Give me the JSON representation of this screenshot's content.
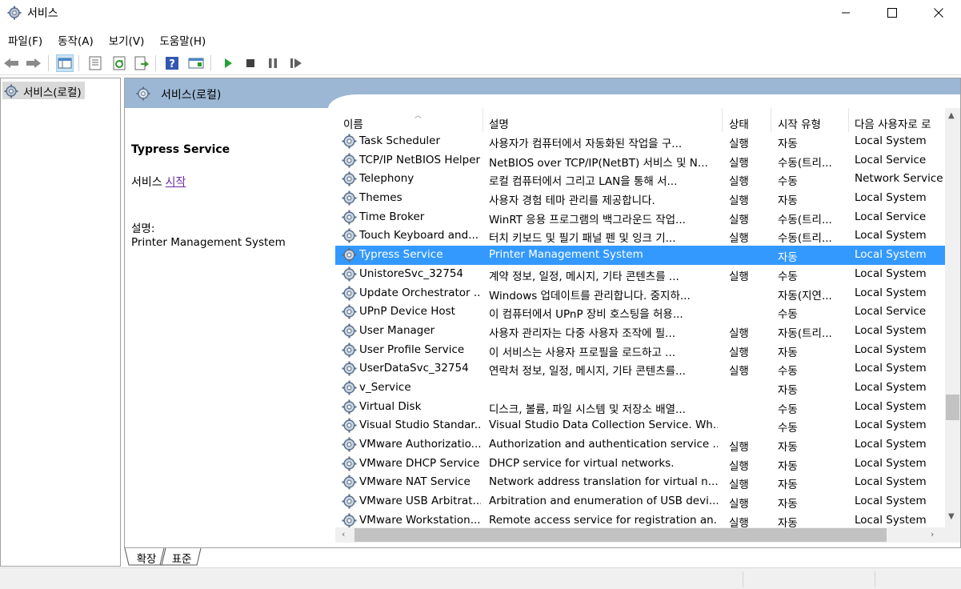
{
  "window": {
    "title": "서비스"
  },
  "menu": [
    "파일(F)",
    "동작(A)",
    "보기(V)",
    "도움말(H)"
  ],
  "toolbar": {
    "buttons": [
      "back-icon",
      "forward-icon",
      "show-hide-console-tree-icon",
      "properties-icon",
      "refresh-icon",
      "export-list-icon",
      "help-icon",
      "show-hide-action-pane-icon",
      "start-service-icon",
      "stop-service-icon",
      "pause-service-icon",
      "resume-service-icon"
    ]
  },
  "tree": {
    "root_label": "서비스(로컬)"
  },
  "pane": {
    "header_title": "서비스(로컬)",
    "selected_name": "Typress Service",
    "service_prefix": "서비스",
    "start_link": "시작",
    "desc_label": "설명:",
    "desc_text": "Printer Management System"
  },
  "columns": {
    "name": "이름",
    "desc": "설명",
    "status": "상태",
    "type": "시작 유형",
    "logon": "다음 사용자로 로"
  },
  "rows": [
    {
      "name": "Task Scheduler",
      "desc": "사용자가 컴퓨터에서 자동화된 작업을 구...",
      "status": "실행",
      "type": "자동",
      "logon": "Local System",
      "selected": false
    },
    {
      "name": "TCP/IP NetBIOS Helper",
      "desc": "NetBIOS over TCP/IP(NetBT) 서비스 및 N...",
      "status": "실행",
      "type": "수동(트리...",
      "logon": "Local Service",
      "selected": false
    },
    {
      "name": "Telephony",
      "desc": "로컬 컴퓨터에서 그리고 LAN을 통해 서...",
      "status": "실행",
      "type": "수동",
      "logon": "Network Service",
      "selected": false
    },
    {
      "name": "Themes",
      "desc": "사용자 경험 테마 관리를 제공합니다.",
      "status": "실행",
      "type": "자동",
      "logon": "Local System",
      "selected": false
    },
    {
      "name": "Time Broker",
      "desc": "WinRT 응용 프로그램의 백그라운드 작업...",
      "status": "실행",
      "type": "수동(트리...",
      "logon": "Local Service",
      "selected": false
    },
    {
      "name": "Touch Keyboard and...",
      "desc": "터치 키보드 및 필기 패널 펜 및 잉크 기...",
      "status": "실행",
      "type": "수동(트리...",
      "logon": "Local System",
      "selected": false
    },
    {
      "name": "Typress Service",
      "desc": "Printer Management System",
      "status": "",
      "type": "자동",
      "logon": "Local System",
      "selected": true
    },
    {
      "name": "UnistoreSvc_32754",
      "desc": "계약 정보, 일정, 메시지, 기타 콘텐츠를 ...",
      "status": "실행",
      "type": "수동",
      "logon": "Local System",
      "selected": false
    },
    {
      "name": "Update Orchestrator ...",
      "desc": "Windows 업데이트를 관리합니다. 중지하...",
      "status": "",
      "type": "자동(지연...",
      "logon": "Local System",
      "selected": false
    },
    {
      "name": "UPnP Device Host",
      "desc": "이 컴퓨터에서 UPnP 장비 호스팅을 허용...",
      "status": "",
      "type": "수동",
      "logon": "Local Service",
      "selected": false
    },
    {
      "name": "User Manager",
      "desc": "사용자 관리자는 다중 사용자 조작에 필...",
      "status": "실행",
      "type": "자동(트리...",
      "logon": "Local System",
      "selected": false
    },
    {
      "name": "User Profile Service",
      "desc": "이 서비스는 사용자 프로필을 로드하고 ...",
      "status": "실행",
      "type": "자동",
      "logon": "Local System",
      "selected": false
    },
    {
      "name": "UserDataSvc_32754",
      "desc": "연락처 정보, 일정, 메시지, 기타 콘텐츠를...",
      "status": "실행",
      "type": "수동",
      "logon": "Local System",
      "selected": false
    },
    {
      "name": "v_Service",
      "desc": "",
      "status": "",
      "type": "자동",
      "logon": "Local System",
      "selected": false
    },
    {
      "name": "Virtual Disk",
      "desc": "디스크, 볼륨, 파일 시스템 및 저장소 배열...",
      "status": "",
      "type": "수동",
      "logon": "Local System",
      "selected": false
    },
    {
      "name": "Visual Studio Standar...",
      "desc": "Visual Studio Data Collection Service. Wh...",
      "status": "",
      "type": "수동",
      "logon": "Local System",
      "selected": false
    },
    {
      "name": "VMware Authorizatio...",
      "desc": "Authorization and authentication service ...",
      "status": "실행",
      "type": "자동",
      "logon": "Local System",
      "selected": false
    },
    {
      "name": "VMware DHCP Service",
      "desc": "DHCP service for virtual networks.",
      "status": "실행",
      "type": "자동",
      "logon": "Local System",
      "selected": false
    },
    {
      "name": "VMware NAT Service",
      "desc": "Network address translation for virtual n...",
      "status": "실행",
      "type": "자동",
      "logon": "Local System",
      "selected": false
    },
    {
      "name": "VMware USB Arbitrat...",
      "desc": "Arbitration and enumeration of USB devi...",
      "status": "실행",
      "type": "자동",
      "logon": "Local System",
      "selected": false
    },
    {
      "name": "VMware Workstation...",
      "desc": "Remote access service for registration an...",
      "status": "실행",
      "type": "자동",
      "logon": "Local System",
      "selected": false
    }
  ],
  "tabs": [
    "확장",
    "표준"
  ],
  "colors": {
    "selection": "#3399ff",
    "pane_header": "#9bb7d4",
    "link": "#6b2fa3"
  }
}
